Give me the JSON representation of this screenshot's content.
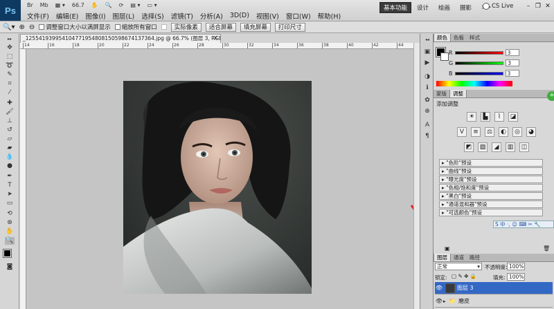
{
  "app": {
    "logo": "Ps"
  },
  "menu": {
    "row1_small": [
      "Br",
      "Mb",
      "66.7",
      "",
      "",
      "",
      ""
    ],
    "items": [
      "文件(F)",
      "编辑(E)",
      "图像(I)",
      "图层(L)",
      "选择(S)",
      "滤镜(T)",
      "分析(A)",
      "3D(D)",
      "视图(V)",
      "窗口(W)",
      "帮助(H)"
    ]
  },
  "zoom_level": "66.7",
  "workspace": {
    "items": [
      "基本功能",
      "设计",
      "绘画",
      "摄影",
      ">>"
    ],
    "active_index": 0
  },
  "cslive": "CS Live",
  "options": {
    "checkbox1": "调整窗口大小以满屏显示",
    "checkbox2": "缩放所有窗口",
    "buttons": [
      "实际像素",
      "适合屏幕",
      "填充屏幕",
      "打印尺寸"
    ]
  },
  "document": {
    "tab_title": "_1255419399541047719548081505986741373​64.jpg @ 66.7% (图层 3, RGB/8#) *",
    "tab_close": "×"
  },
  "ruler_ticks": [
    "14",
    "16",
    "18",
    "20",
    "22",
    "24",
    "26",
    "28",
    "30",
    "32",
    "34",
    "36",
    "38",
    "40",
    "42",
    "44"
  ],
  "color_panel": {
    "tabs": [
      "颜色",
      "色板",
      "样式"
    ],
    "rows": [
      {
        "label": "R",
        "value": "3"
      },
      {
        "label": "G",
        "value": "3"
      },
      {
        "label": "B",
        "value": "3"
      }
    ]
  },
  "adjust_panel": {
    "tabs": [
      "蒙版",
      "调整"
    ],
    "title": "添加调整",
    "presets": [
      "\"色阶\"预设",
      "\"曲线\"预设",
      "\"曝光度\"预设",
      "\"色相/饱和度\"预设",
      "\"黑白\"预设",
      "\"通道混和器\"预设",
      "\"可选颜色\"预设"
    ]
  },
  "layers_panel": {
    "tabs": [
      "图层",
      "通道",
      "路径"
    ],
    "blend_mode": "正常",
    "opacity_label": "不透明度:",
    "opacity": "100%",
    "lock_label": "锁定:",
    "fill_label": "填充:",
    "fill": "100%",
    "layers": [
      {
        "name": "图层 3",
        "selected": true
      },
      {
        "name": "磨皮",
        "selected": false
      }
    ]
  },
  "colors": {
    "accent": "#3468c5",
    "arrow": "#e0262a",
    "workspace_active": "#3b3b3b"
  }
}
